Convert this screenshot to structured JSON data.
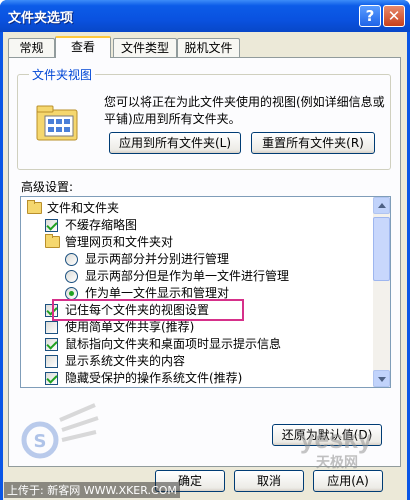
{
  "window": {
    "title": "文件夹选项",
    "help_glyph": "?",
    "close_glyph": "✕"
  },
  "tabs": [
    {
      "label": "常规"
    },
    {
      "label": "查看"
    },
    {
      "label": "文件类型"
    },
    {
      "label": "脱机文件"
    }
  ],
  "folder_views": {
    "legend": "文件夹视图",
    "description": "您可以将正在为此文件夹使用的视图(例如详细信息或平铺)应用到所有文件夹。",
    "apply_button": "应用到所有文件夹(L)",
    "reset_button": "重置所有文件夹(R)"
  },
  "advanced": {
    "label": "高级设置:",
    "items": [
      {
        "type": "folder",
        "label": "文件和文件夹"
      },
      {
        "type": "checkbox",
        "checked": true,
        "label": "不缓存缩略图"
      },
      {
        "type": "folder",
        "label": "管理网页和文件夹对"
      },
      {
        "type": "radio",
        "selected": false,
        "label": "显示两部分并分别进行管理"
      },
      {
        "type": "radio",
        "selected": false,
        "label": "显示两部分但是作为单一文件进行管理"
      },
      {
        "type": "radio",
        "selected": true,
        "label": "作为单一文件显示和管理对"
      },
      {
        "type": "checkbox",
        "checked": true,
        "label": "记住每个文件夹的视图设置"
      },
      {
        "type": "checkbox",
        "checked": false,
        "label": "使用简单文件共享(推荐)"
      },
      {
        "type": "checkbox",
        "checked": true,
        "label": "鼠标指向文件夹和桌面项时显示提示信息"
      },
      {
        "type": "checkbox",
        "checked": false,
        "label": "显示系统文件夹的内容"
      },
      {
        "type": "checkbox",
        "checked": true,
        "label": "隐藏受保护的操作系统文件(推荐)"
      }
    ],
    "restore_button": "还原为默认值(D)"
  },
  "footer": {
    "ok": "确定",
    "cancel": "取消",
    "apply": "应用(A)"
  },
  "watermarks": {
    "yesky": "yesky",
    "yesky_cn": "天极网",
    "upload": "上传于: 新客网 WWW.XKER.COM"
  },
  "colors": {
    "title_blue": "#0a56e6",
    "dialog_bg": "#ece9d8",
    "legend_blue": "#0046d5",
    "highlight": "#d6308a"
  }
}
